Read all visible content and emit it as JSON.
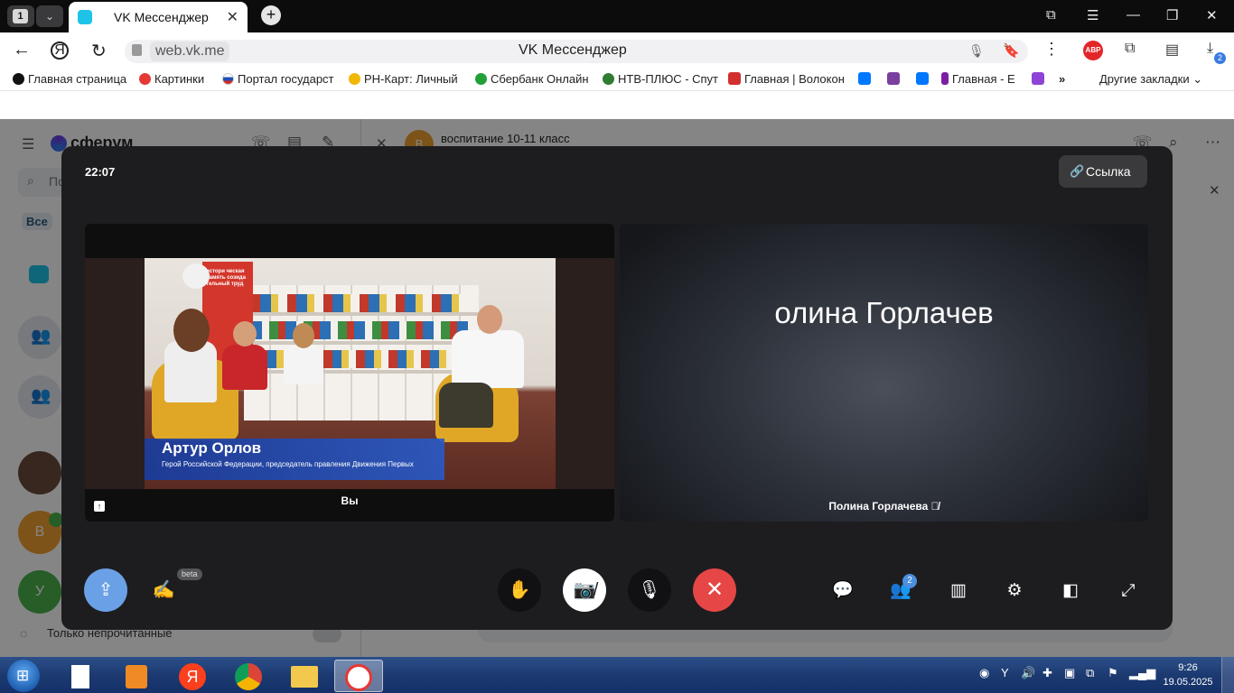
{
  "browser": {
    "tab_count": "1",
    "active_tab_title": "VK Мессенджер",
    "address_domain": "web.vk.me",
    "address_page_title": "VK Мессенджер",
    "abp_label": "ABP",
    "downloads_badge": "2"
  },
  "bookmarks": [
    {
      "label": "Главная страница",
      "icon": "globe-icon",
      "color": "#111111"
    },
    {
      "label": "Картинки",
      "icon": "yandex-icon",
      "color": "#e53935"
    },
    {
      "label": "Портал государст",
      "icon": "flag-icon",
      "color": "#1e4fb5"
    },
    {
      "label": "РН-Карт: Личный",
      "icon": "rn-icon",
      "color": "#f2b705"
    },
    {
      "label": "Сбербанк Онлайн",
      "icon": "sber-icon",
      "color": "#21a038"
    },
    {
      "label": "НТВ-ПЛЮС - Спут",
      "icon": "ntv-icon",
      "color": "#2e7d32"
    },
    {
      "label": "Главная | Волокон",
      "icon": "crest-icon",
      "color": "#d32f2f"
    },
    {
      "label": "Главная - Е",
      "icon": "feather-icon",
      "color": "#7b1fa2"
    }
  ],
  "bookmarks_other": "Другие закладки",
  "vk": {
    "logo": "сферум",
    "search_placeholder": "По",
    "filter_all": "Все",
    "only_unread": "Только непрочитанные",
    "chat_title": "воспитание 10-11 класс",
    "chat_avatar_letter": "В",
    "avatar_letter_v": "В",
    "avatar_letter_u": "У"
  },
  "call": {
    "timer": "22:07",
    "link_button": "Ссылка",
    "self_label": "Вы",
    "remote_name_big": "олина Горлачев",
    "remote_label": "Полина Горлачева",
    "beta_badge": "beta",
    "participants_badge": "2",
    "video": {
      "banner_text": "истори ческая память созида тельный труд",
      "lower_third_name": "Артур Орлов",
      "lower_third_subtitle": "Герой Российской Федерации, председатель правления Движения Первых"
    }
  },
  "taskbar": {
    "yandex_letter": "Я",
    "clock_time": "9:26",
    "clock_date": "19.05.2025"
  }
}
